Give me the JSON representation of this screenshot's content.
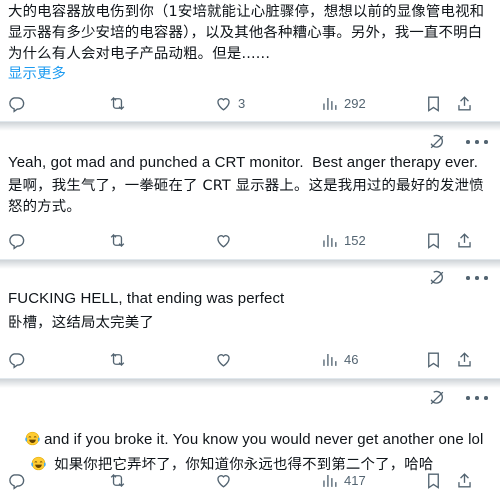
{
  "replies": [
    {
      "translated_text": "大的电容器放电伤到你（1安培就能让心脏骤停，想想以前的显像管电视和显示器有多少安培的电容器），以及其他各种糟心事。另外，我一直不明白为什么有人会对电子产品动粗。但是......",
      "show_more": "显示更多",
      "likes": "3",
      "views": "292"
    },
    {
      "text": "Yeah, got mad and punched a CRT monitor.  Best anger therapy ever.",
      "translated_text": "是啊，我生气了，一拳砸在了 CRT 显示器上。这是我用过的最好的发泄愤怒的方式。",
      "views": "152"
    },
    {
      "text": "FUCKING HELL, that ending was perfect",
      "translated_text": "卧槽，这结局太完美了",
      "views": "46"
    },
    {
      "text": "and if you broke it. You know you would never get another one lol",
      "translated_text": "如果你把它弄坏了，你知道你永远也得不到第二个了，哈哈",
      "emoji": "face-with-tears-of-joy",
      "views": "417"
    }
  ],
  "icons": {
    "reply": "reply-icon",
    "repost": "repost-icon",
    "like": "like-icon",
    "views": "views-icon",
    "bookmark": "bookmark-icon",
    "share": "share-icon",
    "grok": "grok-icon",
    "more": "more-icon"
  },
  "colors": {
    "text": "#0f1419",
    "muted": "#536471",
    "link": "#1d9bf0",
    "divider": "#e1e8ed"
  }
}
